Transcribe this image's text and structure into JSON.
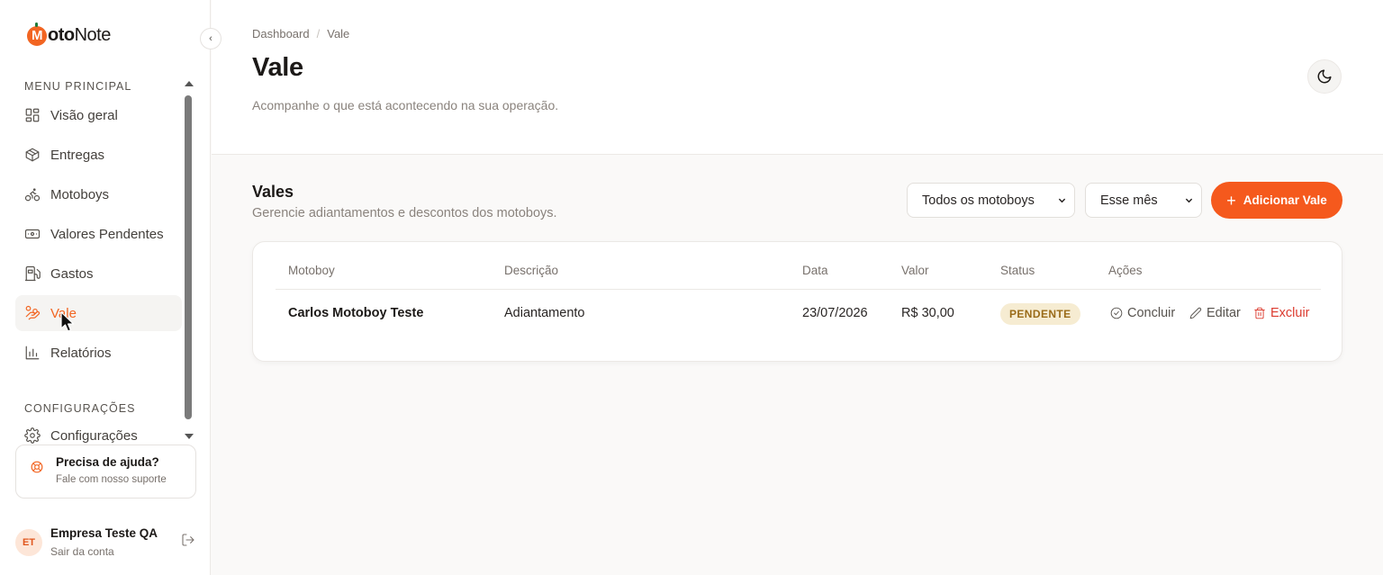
{
  "brand": {
    "logo_letter": "M",
    "logo_bold": "oto",
    "logo_light": "Note"
  },
  "sidebar": {
    "menu_label": "MENU PRINCIPAL",
    "items": [
      {
        "label": "Visão geral",
        "icon": "grid-icon"
      },
      {
        "label": "Entregas",
        "icon": "package-icon"
      },
      {
        "label": "Motoboys",
        "icon": "bike-icon"
      },
      {
        "label": "Valores Pendentes",
        "icon": "banknote-icon"
      },
      {
        "label": "Gastos",
        "icon": "fuel-icon"
      },
      {
        "label": "Vale",
        "icon": "hand-coins-icon",
        "active": true
      },
      {
        "label": "Relatórios",
        "icon": "bar-chart-icon"
      }
    ],
    "config_label": "CONFIGURAÇÕES",
    "config_item": "Configurações",
    "help": {
      "title": "Precisa de ajuda?",
      "subtitle": "Fale com nosso suporte"
    },
    "user": {
      "initials": "ET",
      "name": "Empresa Teste QA",
      "logout": "Sair da conta"
    }
  },
  "header": {
    "breadcrumb": [
      "Dashboard",
      "Vale"
    ],
    "title": "Vale",
    "subtitle": "Acompanhe o que está acontecendo na sua operação."
  },
  "section": {
    "title": "Vales",
    "subtitle": "Gerencie adiantamentos e descontos dos motoboys.",
    "filter_motoboy": "Todos os motoboys",
    "filter_period": "Esse mês",
    "add_button": "Adicionar Vale"
  },
  "table": {
    "columns": [
      "Motoboy",
      "Descrição",
      "Data",
      "Valor",
      "Status",
      "Ações"
    ],
    "rows": [
      {
        "motoboy": "Carlos Motoboy Teste",
        "descricao": "Adiantamento",
        "data": "23/07/2026",
        "valor": "R$ 30,00",
        "status": "PENDENTE",
        "actions": {
          "complete": "Concluir",
          "edit": "Editar",
          "delete": "Excluir"
        }
      }
    ]
  },
  "colors": {
    "accent": "#f5591d",
    "pending_bg": "#f6ecd2",
    "pending_text": "#9a6b18",
    "danger": "#dc3b2f"
  }
}
